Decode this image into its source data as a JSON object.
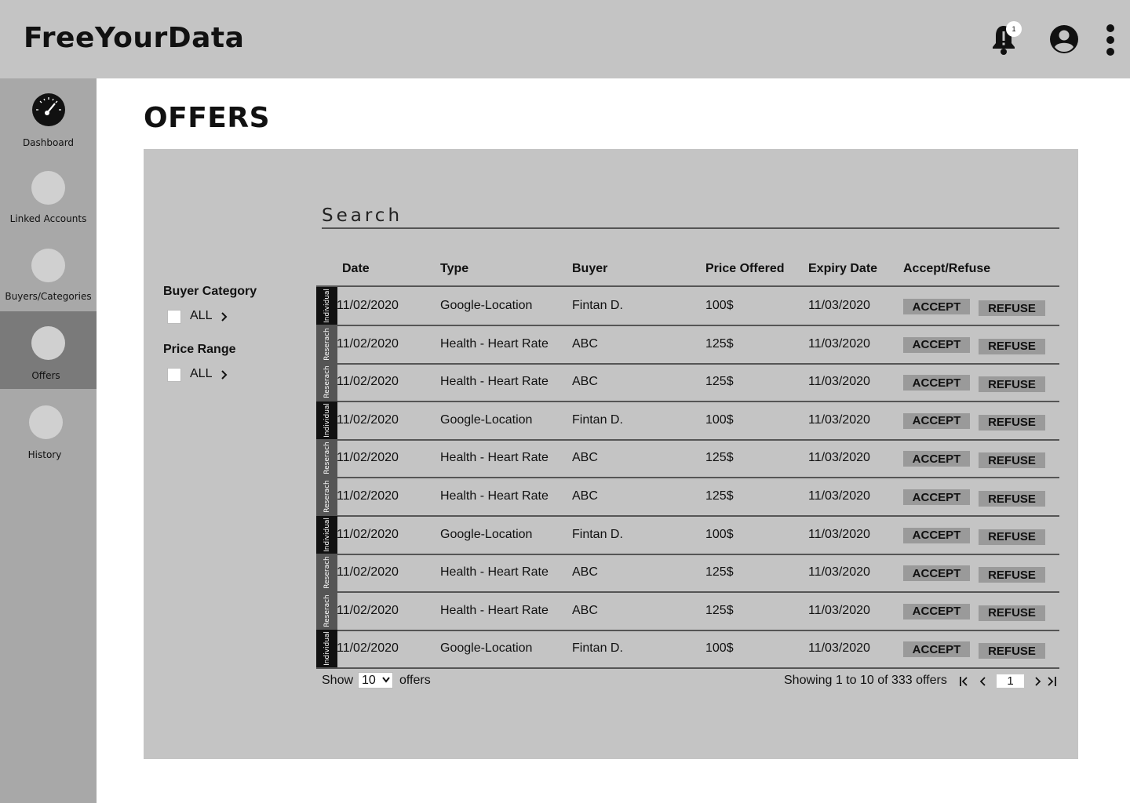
{
  "app": {
    "title": "FreeYourData"
  },
  "header": {
    "notification_count": "1"
  },
  "sidebar": {
    "items": [
      {
        "label": "Dashboard",
        "active": false
      },
      {
        "label": "Linked Accounts",
        "active": false
      },
      {
        "label": "Buyers/Categories",
        "active": false
      },
      {
        "label": "Offers",
        "active": true
      },
      {
        "label": "History",
        "active": false
      }
    ]
  },
  "page": {
    "title": "OFFERS"
  },
  "search": {
    "placeholder": "Search"
  },
  "filters": {
    "buyer_category": {
      "title": "Buyer Category",
      "value": "ALL"
    },
    "price_range": {
      "title": "Price Range",
      "value": "ALL"
    }
  },
  "table": {
    "columns": [
      "Date",
      "Type",
      "Buyer",
      "Price Offered",
      "Expiry Date",
      "Accept/Refuse"
    ],
    "accept_label": "ACCEPT",
    "refuse_label": "REFUSE",
    "rows": [
      {
        "tag": "Individual",
        "date": "11/02/2020",
        "type": "Google-Location",
        "buyer": "Fintan D.",
        "price": "100$",
        "expiry": "11/03/2020"
      },
      {
        "tag": "Reserach",
        "date": "11/02/2020",
        "type": "Health - Heart Rate",
        "buyer": "ABC",
        "price": "125$",
        "expiry": "11/03/2020"
      },
      {
        "tag": "Reserach",
        "date": "11/02/2020",
        "type": "Health - Heart Rate",
        "buyer": "ABC",
        "price": "125$",
        "expiry": "11/03/2020"
      },
      {
        "tag": "Individual",
        "date": "11/02/2020",
        "type": "Google-Location",
        "buyer": "Fintan D.",
        "price": "100$",
        "expiry": "11/03/2020"
      },
      {
        "tag": "Reserach",
        "date": "11/02/2020",
        "type": "Health - Heart Rate",
        "buyer": "ABC",
        "price": "125$",
        "expiry": "11/03/2020"
      },
      {
        "tag": "Reserach",
        "date": "11/02/2020",
        "type": "Health - Heart Rate",
        "buyer": "ABC",
        "price": "125$",
        "expiry": "11/03/2020"
      },
      {
        "tag": "Individual",
        "date": "11/02/2020",
        "type": "Google-Location",
        "buyer": "Fintan D.",
        "price": "100$",
        "expiry": "11/03/2020"
      },
      {
        "tag": "Reserach",
        "date": "11/02/2020",
        "type": "Health - Heart Rate",
        "buyer": "ABC",
        "price": "125$",
        "expiry": "11/03/2020"
      },
      {
        "tag": "Reserach",
        "date": "11/02/2020",
        "type": "Health - Heart Rate",
        "buyer": "ABC",
        "price": "125$",
        "expiry": "11/03/2020"
      },
      {
        "tag": "Individual",
        "date": "11/02/2020",
        "type": "Google-Location",
        "buyer": "Fintan D.",
        "price": "100$",
        "expiry": "11/03/2020"
      }
    ]
  },
  "footer": {
    "show_label": "Show",
    "page_size": "10",
    "offers_label": "offers",
    "summary": "Showing 1 to 10 of 333 offers",
    "current_page": "1"
  }
}
